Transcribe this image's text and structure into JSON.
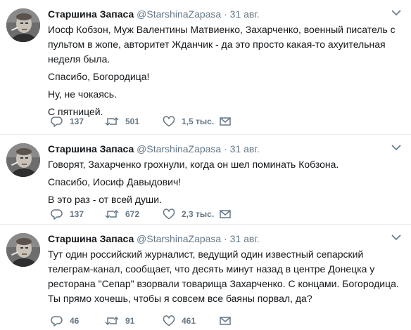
{
  "tweets": [
    {
      "author_name": "Старшина Запаса",
      "handle": "@StarshinaZapasa",
      "separator": "·",
      "date": "31 авг.",
      "paragraphs": [
        "Иосф Кобзон, Муж Валентины Матвиенко, Захарченко, военный писатель с пультом в жопе, авторитет Жданчик - да это просто какая-то ахуительная неделя была.",
        "Спасибо, Богородица!",
        "Ну, не чокаясь.",
        "С пятницей."
      ],
      "replies": "137",
      "retweets": "501",
      "likes": "1,5 тыс."
    },
    {
      "author_name": "Старшина Запаса",
      "handle": "@StarshinaZapasa",
      "separator": "·",
      "date": "31 авг.",
      "paragraphs": [
        "Говорят, Захарченко грохнули, когда он шел поминать Кобзона.",
        "Спасибо, Иосиф Давыдович!",
        "В это раз - от всей души."
      ],
      "replies": "137",
      "retweets": "672",
      "likes": "2,3 тыс."
    },
    {
      "author_name": "Старшина Запаса",
      "handle": "@StarshinaZapasa",
      "separator": "·",
      "date": "31 авг.",
      "paragraphs": [
        "Тут один российский журналист, ведущий один известный сепарский телеграм-канал, сообщает, что десять минут назад в центре Донецка у ресторана \"Сепар\" взорвали товарища Захарченко. С концами. Богородица. Ты прямо хочешь, чтобы я совсем все баяны порвал, да?"
      ],
      "replies": "46",
      "retweets": "91",
      "likes": "461"
    }
  ],
  "icons": {
    "reply": "reply-icon",
    "retweet": "retweet-icon",
    "like": "heart-icon",
    "dm": "envelope-icon",
    "caret": "chevron-down-icon",
    "avatar": "avatar"
  },
  "colors": {
    "icon_gray": "#657786",
    "text": "#14171a",
    "divider": "#e6ecf0"
  }
}
